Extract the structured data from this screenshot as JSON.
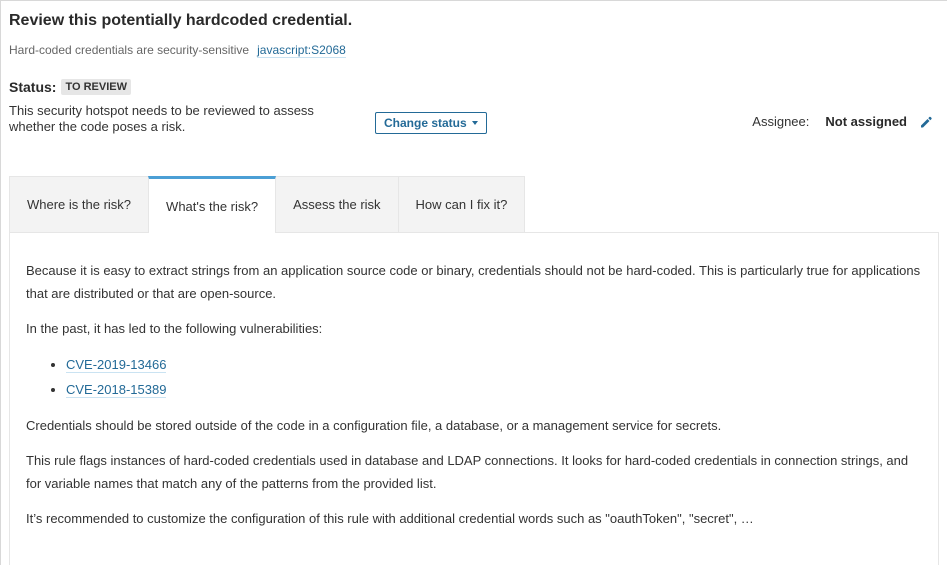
{
  "header": {
    "title": "Review this potentially hardcoded credential.",
    "subtitle": "Hard-coded credentials are security-sensitive",
    "rule_key": "javascript:S2068"
  },
  "status": {
    "label": "Status:",
    "value": "TO REVIEW",
    "description": "This security hotspot needs to be reviewed to assess whether the code poses a risk.",
    "change_button": "Change status"
  },
  "assignee": {
    "label": "Assignee:",
    "value": "Not assigned",
    "edit_icon": "pencil-icon"
  },
  "tabs": [
    {
      "label": "Where is the risk?",
      "active": false
    },
    {
      "label": "What's the risk?",
      "active": true
    },
    {
      "label": "Assess the risk",
      "active": false
    },
    {
      "label": "How can I fix it?",
      "active": false
    }
  ],
  "content": {
    "paragraph1": "Because it is easy to extract strings from an application source code or binary, credentials should not be hard-coded. This is particularly true for applications that are distributed or that are open-source.",
    "paragraph2": "In the past, it has led to the following vulnerabilities:",
    "vulnerabilities": [
      "CVE-2019-13466",
      "CVE-2018-15389"
    ],
    "paragraph3": "Credentials should be stored outside of the code in a configuration file, a database, or a management service for secrets.",
    "paragraph4": "This rule flags instances of hard-coded credentials used in database and LDAP connections. It looks for hard-coded credentials in connection strings, and for variable names that match any of the patterns from the provided list.",
    "paragraph5": "It’s recommended to customize the configuration of this rule with additional credential words such as \"oauthToken\", \"secret\", …"
  },
  "colors": {
    "link": "#236a97",
    "active_tab_accent": "#4b9fd5"
  }
}
